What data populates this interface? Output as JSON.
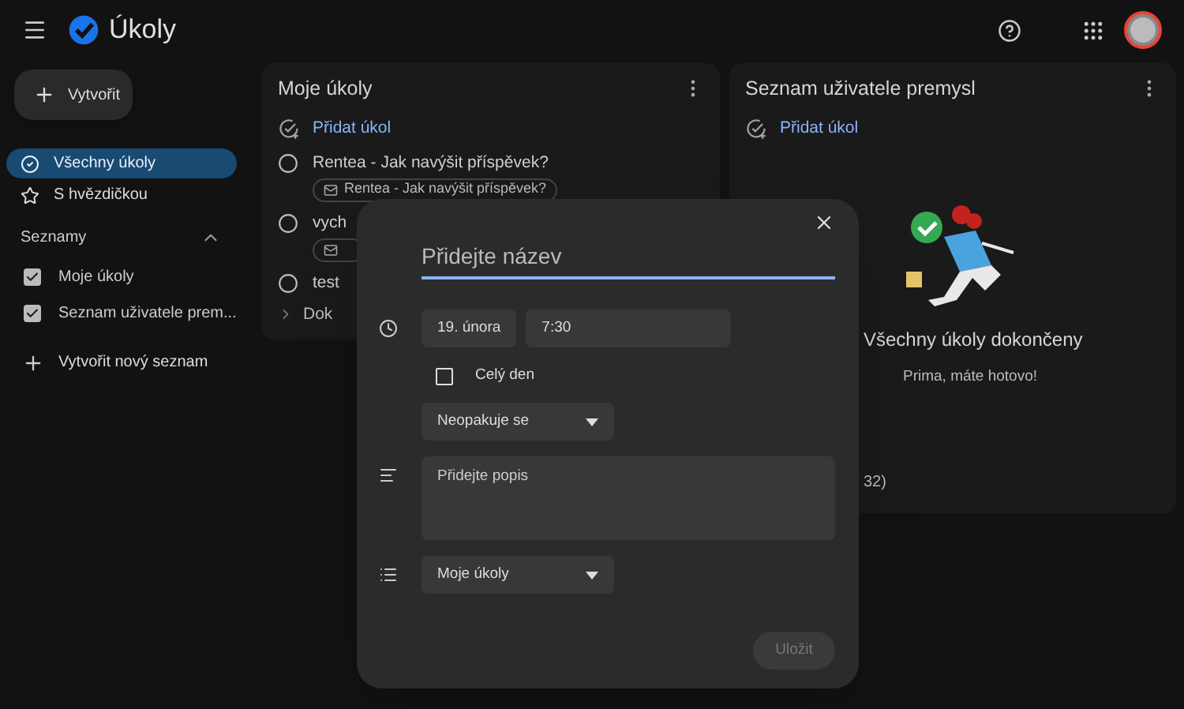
{
  "app": {
    "title": "Úkoly"
  },
  "sidebar": {
    "create_button": "Vytvořit",
    "nav": [
      {
        "label": "Všechny úkoly",
        "selected": true,
        "kind": "all"
      },
      {
        "label": "S hvězdičkou",
        "selected": false,
        "kind": "starred"
      }
    ],
    "lists_section": {
      "title": "Seznamy",
      "expanded": true,
      "lists": [
        {
          "label": "Moje úkoly",
          "checked": true
        },
        {
          "label": "Seznam uživatele prem...",
          "checked": true
        }
      ]
    },
    "new_list": "Vytvořit nový seznam"
  },
  "lists": [
    {
      "title": "Moje úkoly",
      "add_task": "Přidat úkol",
      "tasks": [
        {
          "title": "Rentea - Jak navýšit příspěvek?",
          "completed": false,
          "email_chip": true,
          "email_chip_text": "Rentea - Jak navýšit příspěvek?"
        },
        {
          "title": "vych",
          "completed": false,
          "email_chip": true
        },
        {
          "title": "test",
          "completed": false,
          "email_chip": false
        }
      ],
      "completed_section": "Dok"
    },
    {
      "title": "Seznam uživatele premysl",
      "add_task": "Přidat úkol",
      "empty_title": "Všechny úkoly dokončeny",
      "empty_text": "Prima, máte hotovo!",
      "completed_section": "32)"
    }
  ],
  "dialog": {
    "title_placeholder": "Přidejte název",
    "date": "19. února",
    "time": "7:30",
    "all_day": {
      "label": "Celý den",
      "checked": false
    },
    "repeat": "Neopakuje se",
    "description_placeholder": "Přidejte popis",
    "list": "Moje úkoly",
    "save_button": {
      "label": "Uložit",
      "disabled": true
    }
  }
}
